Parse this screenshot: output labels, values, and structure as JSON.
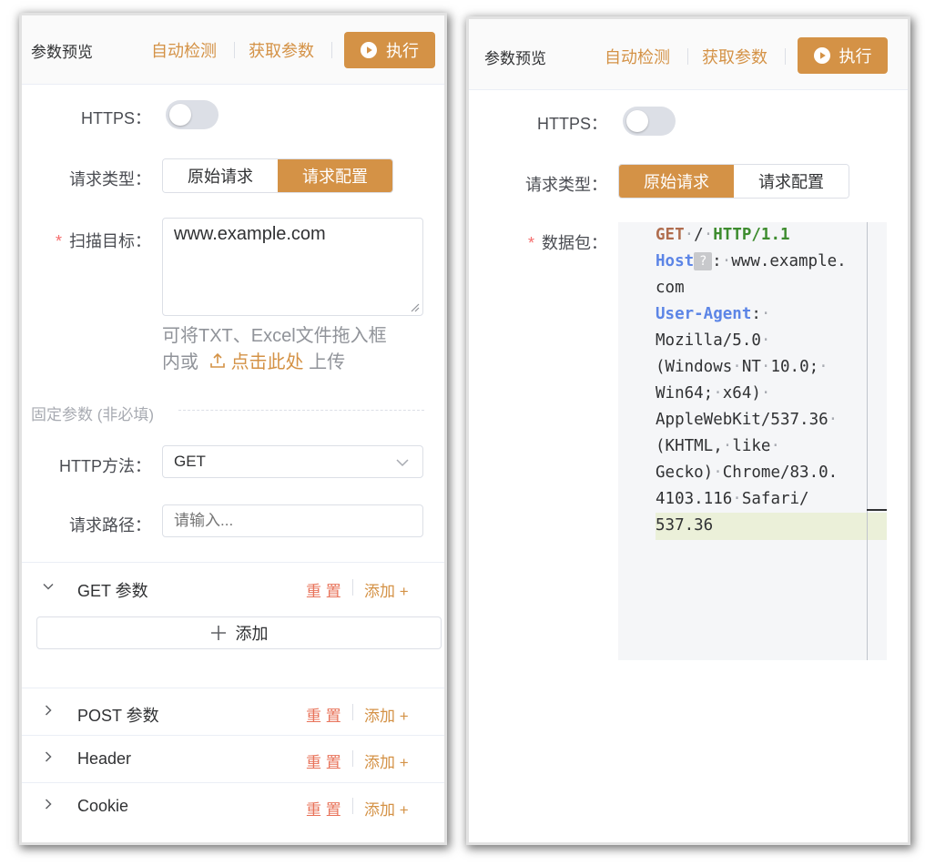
{
  "left": {
    "header": {
      "title": "参数预览",
      "auto_detect": "自动检测",
      "get_params": "获取参数",
      "run": "执行"
    },
    "form": {
      "https_label": "HTTPS：",
      "https_enabled": false,
      "req_type_label": "请求类型：",
      "req_type_options": [
        "原始请求",
        "请求配置"
      ],
      "req_type_selected": "请求配置",
      "target_label": "扫描目标：",
      "target_value": "www.example.com",
      "hint_prefix": "可将TXT、Excel文件拖入框",
      "hint_mid": "内或",
      "hint_link": "点击此处",
      "hint_suffix": "上传",
      "fixed_params": "固定参数 (非必填)",
      "method_label": "HTTP方法：",
      "method_value": "GET",
      "path_label": "请求路径：",
      "path_placeholder": "请输入..."
    },
    "sections": [
      {
        "title": "GET 参数",
        "expanded": true,
        "reset": "重 置",
        "add": "添加 +"
      },
      {
        "title": "POST 参数",
        "expanded": false,
        "reset": "重 置",
        "add": "添加 +"
      },
      {
        "title": "Header",
        "expanded": false,
        "reset": "重 置",
        "add": "添加 +"
      },
      {
        "title": "Cookie",
        "expanded": false,
        "reset": "重 置",
        "add": "添加 +"
      }
    ],
    "add_row_label": "添加"
  },
  "right": {
    "header": {
      "title": "参数预览",
      "auto_detect": "自动检测",
      "get_params": "获取参数",
      "run": "执行"
    },
    "form": {
      "https_label": "HTTPS：",
      "https_enabled": false,
      "req_type_label": "请求类型：",
      "req_type_options": [
        "原始请求",
        "请求配置"
      ],
      "req_type_selected": "原始请求",
      "packet_label": "数据包："
    },
    "code": {
      "method": "GET",
      "path": "/",
      "version": "HTTP/1.1",
      "host_key": "Host",
      "host_val_1": "www.example.",
      "host_val_2": "com",
      "ua_key": "User-Agent",
      "ua_lines": [
        "Mozilla/5.0",
        "(Windows",
        "NT",
        "10.0;",
        "Win64;",
        "x64)",
        "AppleWebKit/537.36",
        "(KHTML,",
        "like",
        "Gecko)",
        "Chrome/83.0.",
        "4103.116",
        "Safari/",
        "537.36"
      ]
    }
  },
  "colors": {
    "accent": "#d49246",
    "danger": "#e8735a",
    "required": "#f56c6c"
  }
}
